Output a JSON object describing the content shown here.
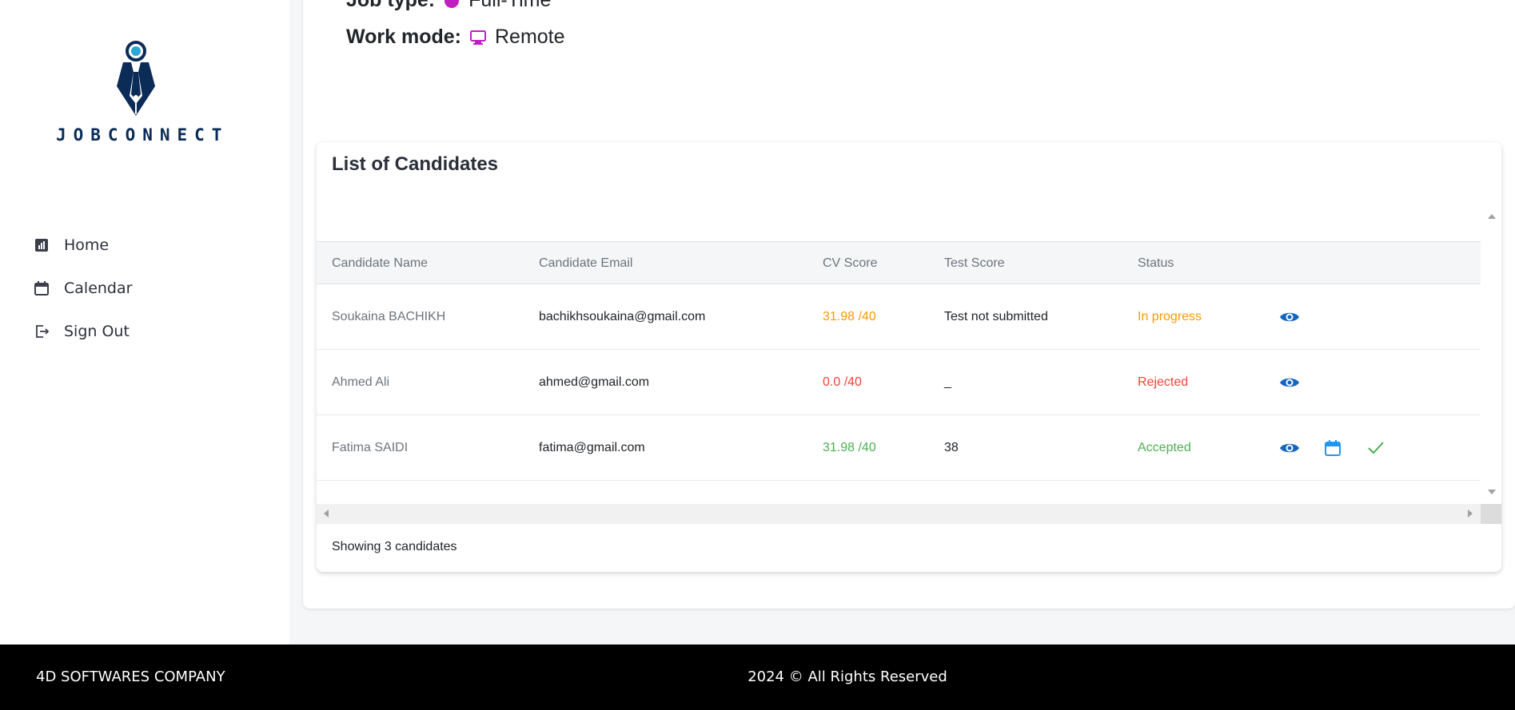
{
  "brand": {
    "name": "JOBCONNECT"
  },
  "sidebar": {
    "items": [
      {
        "label": "Home",
        "icon": "chart-icon"
      },
      {
        "label": "Calendar",
        "icon": "calendar-icon"
      },
      {
        "label": "Sign Out",
        "icon": "logout-icon"
      }
    ]
  },
  "job": {
    "job_type_label": "Job type:",
    "job_type_value": "Full-Time",
    "work_mode_label": "Work mode:",
    "work_mode_value": "Remote"
  },
  "candidates": {
    "title": "List of Candidates",
    "columns": [
      "Candidate Name",
      "Candidate Email",
      "CV Score",
      "Test Score",
      "Status"
    ],
    "rows": [
      {
        "name": "Soukaina BACHIKH",
        "email": "bachikhsoukaina@gmail.com",
        "cv_score": "31.98 /40",
        "test_score": "Test not submitted",
        "status": "In progress",
        "cv_color": "#ff9800",
        "status_color": "#ff9800"
      },
      {
        "name": "Ahmed Ali",
        "email": "ahmed@gmail.com",
        "cv_score": "0.0 /40",
        "test_score": "_",
        "status": "Rejected",
        "cv_color": "#f44336",
        "status_color": "#f44336"
      },
      {
        "name": "Fatima SAIDI",
        "email": "fatima@gmail.com",
        "cv_score": "31.98 /40",
        "test_score": "38",
        "status": "Accepted",
        "cv_color": "#4caf50",
        "status_color": "#4caf50"
      }
    ],
    "footer_text": "Showing 3 candidates"
  },
  "footer": {
    "company": "4D SOFTWARES COMPANY",
    "copyright": "2024 © All Rights Reserved"
  },
  "colors": {
    "brand_navy": "#0b2c57",
    "eye_blue": "#1565c0",
    "calendar_blue": "#2196f3",
    "accept_green": "#4caf50",
    "jobtype_magenta": "#c21fc2"
  }
}
